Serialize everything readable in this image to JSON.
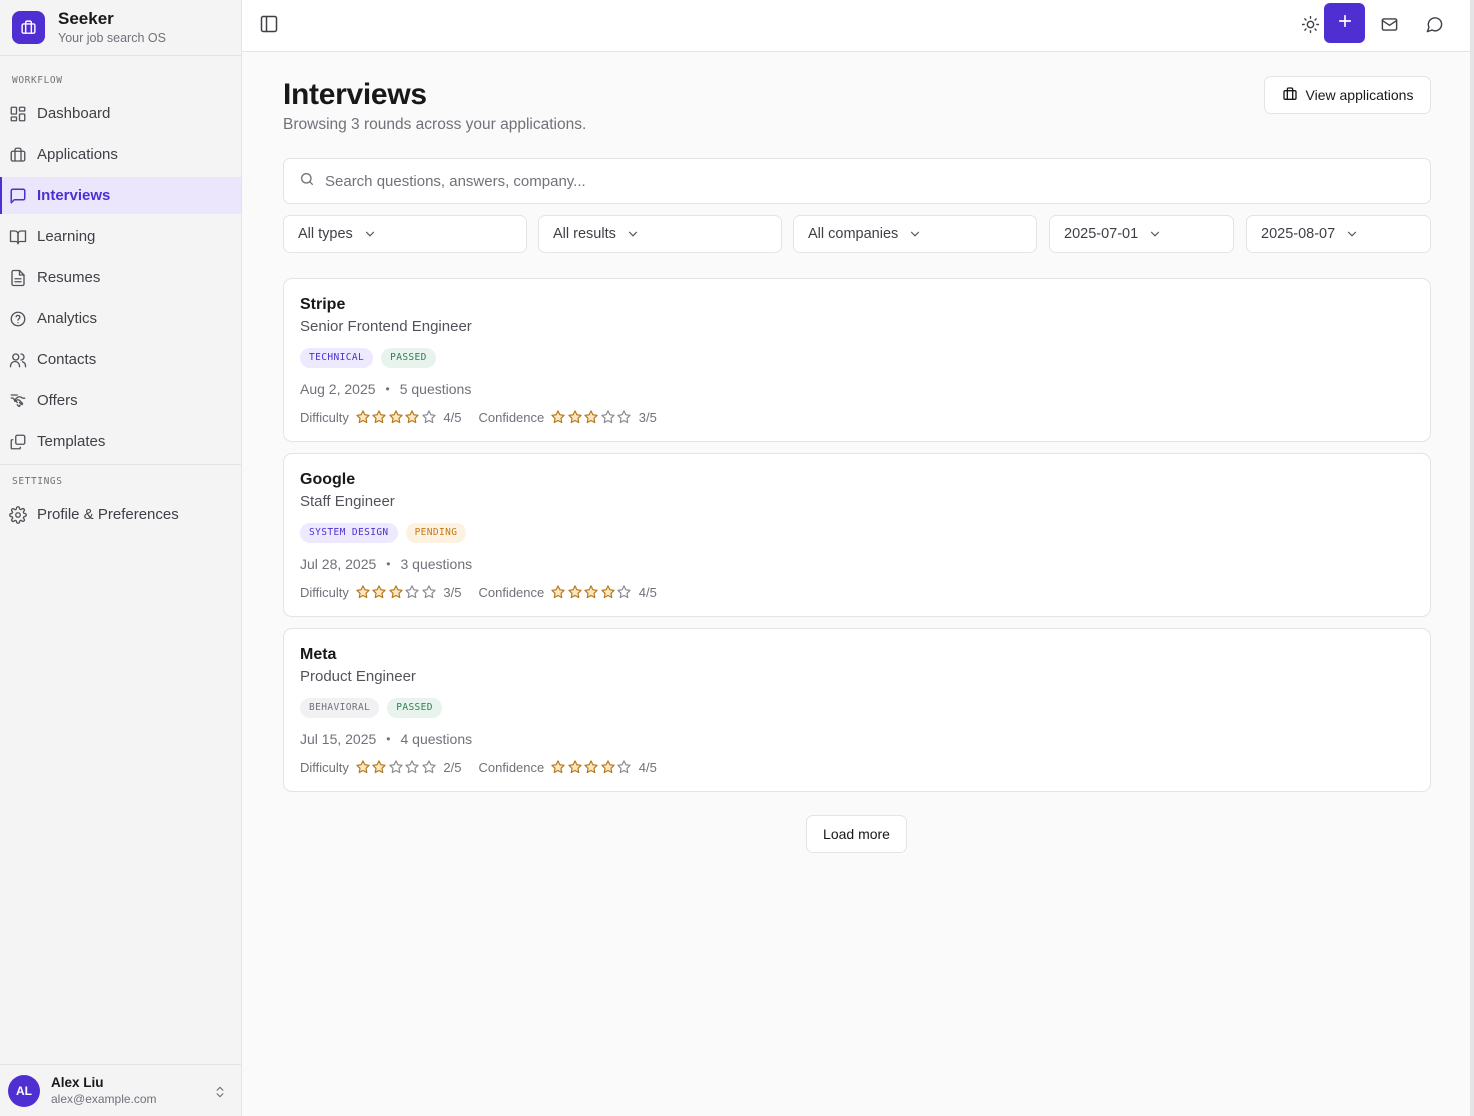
{
  "brand": {
    "name": "Seeker",
    "subtitle": "Your job search OS"
  },
  "sidebar": {
    "workflow_label": "WORKFLOW",
    "settings_label": "SETTINGS",
    "workflow_items": [
      {
        "label": "Dashboard",
        "icon": "dashboard-icon"
      },
      {
        "label": "Applications",
        "icon": "briefcase-icon"
      },
      {
        "label": "Interviews",
        "icon": "message-square-icon",
        "active": true
      },
      {
        "label": "Learning",
        "icon": "book-open-icon"
      },
      {
        "label": "Resumes",
        "icon": "file-text-icon"
      },
      {
        "label": "Analytics",
        "icon": "help-circle-icon"
      },
      {
        "label": "Contacts",
        "icon": "users-icon"
      },
      {
        "label": "Offers",
        "icon": "handshake-icon"
      },
      {
        "label": "Templates",
        "icon": "copy-icon"
      }
    ],
    "settings_items": [
      {
        "label": "Profile & Preferences",
        "icon": "gear-icon"
      }
    ]
  },
  "user": {
    "initials": "AL",
    "name": "Alex Liu",
    "email": "alex@example.com"
  },
  "topbar": {
    "icons": [
      "sidebar-toggle-icon",
      "sun-icon",
      "plus-icon",
      "mail-icon",
      "chat-icon"
    ],
    "accent": "#4f2fd1"
  },
  "page": {
    "title": "Interviews",
    "subtitle": "Browsing 3 rounds across your applications.",
    "view_applications_label": "View applications",
    "load_more_label": "Load more"
  },
  "search": {
    "placeholder": "Search questions, answers, company...",
    "value": ""
  },
  "filters": {
    "type": "All types",
    "result": "All results",
    "company": "All companies",
    "date_from": "2025-07-01",
    "date_to": "2025-08-07"
  },
  "labels": {
    "difficulty": "Difficulty",
    "confidence": "Confidence"
  },
  "interviews": [
    {
      "company": "Stripe",
      "role": "Senior Frontend Engineer",
      "type_badge": "TECHNICAL",
      "result_badge": "PASSED",
      "date": "Aug 2, 2025",
      "questions": "5 questions",
      "difficulty": 4,
      "difficulty_text": "4/5",
      "confidence": 3,
      "confidence_text": "3/5"
    },
    {
      "company": "Google",
      "role": "Staff Engineer",
      "type_badge": "SYSTEM DESIGN",
      "result_badge": "PENDING",
      "date": "Jul 28, 2025",
      "questions": "3 questions",
      "difficulty": 3,
      "difficulty_text": "3/5",
      "confidence": 4,
      "confidence_text": "4/5"
    },
    {
      "company": "Meta",
      "role": "Product Engineer",
      "type_badge": "BEHAVIORAL",
      "result_badge": "PASSED",
      "date": "Jul 15, 2025",
      "questions": "4 questions",
      "difficulty": 2,
      "difficulty_text": "2/5",
      "confidence": 4,
      "confidence_text": "4/5"
    }
  ],
  "badge_colors": {
    "TECHNICAL": {
      "bg": "#ede9fe",
      "fg": "#4f2fd1"
    },
    "SYSTEM DESIGN": {
      "bg": "#ede9fe",
      "fg": "#4f2fd1"
    },
    "BEHAVIORAL": {
      "bg": "#f1f1f3",
      "fg": "#71717a"
    },
    "PASSED": {
      "bg": "#e7f3ec",
      "fg": "#2f7d55"
    },
    "PENDING": {
      "bg": "#fdf1e2",
      "fg": "#c27a13"
    }
  },
  "star_color": "#b7791f"
}
